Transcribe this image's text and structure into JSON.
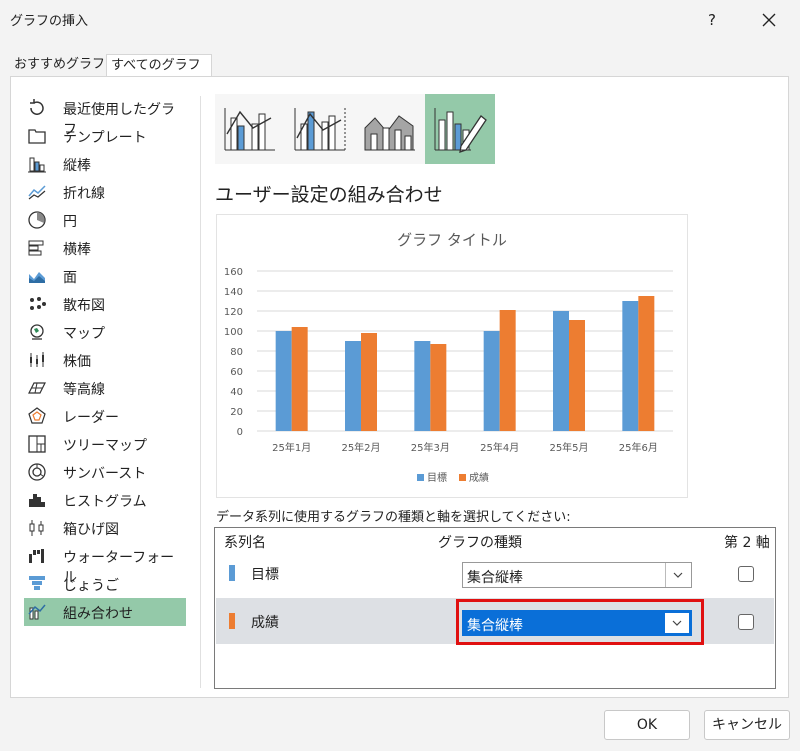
{
  "dialog": {
    "title": "グラフの挿入",
    "help": "?",
    "close_icon": "close-icon"
  },
  "tabs": [
    {
      "label": "おすすめグラフ"
    },
    {
      "label": "すべてのグラフ"
    }
  ],
  "chart_types": [
    {
      "label": "最近使用したグラフ",
      "icon": "recent-icon"
    },
    {
      "label": "テンプレート",
      "icon": "template-folder-icon"
    },
    {
      "label": "縦棒",
      "icon": "column-chart-icon"
    },
    {
      "label": "折れ線",
      "icon": "line-chart-icon"
    },
    {
      "label": "円",
      "icon": "pie-chart-icon"
    },
    {
      "label": "横棒",
      "icon": "bar-chart-icon"
    },
    {
      "label": "面",
      "icon": "area-chart-icon"
    },
    {
      "label": "散布図",
      "icon": "scatter-chart-icon"
    },
    {
      "label": "マップ",
      "icon": "map-chart-icon"
    },
    {
      "label": "株価",
      "icon": "stock-chart-icon"
    },
    {
      "label": "等高線",
      "icon": "surface-chart-icon"
    },
    {
      "label": "レーダー",
      "icon": "radar-chart-icon"
    },
    {
      "label": "ツリーマップ",
      "icon": "treemap-chart-icon"
    },
    {
      "label": "サンバースト",
      "icon": "sunburst-chart-icon"
    },
    {
      "label": "ヒストグラム",
      "icon": "histogram-chart-icon"
    },
    {
      "label": "箱ひげ図",
      "icon": "box-whisker-chart-icon"
    },
    {
      "label": "ウォーターフォール",
      "icon": "waterfall-chart-icon"
    },
    {
      "label": "じょうご",
      "icon": "funnel-chart-icon"
    },
    {
      "label": "組み合わせ",
      "icon": "combo-chart-icon"
    }
  ],
  "selected_chart_type": "組み合わせ",
  "section_title": "ユーザー設定の組み合わせ",
  "chart_data": {
    "type": "bar",
    "title": "グラフ タイトル",
    "categories": [
      "25年1月",
      "25年2月",
      "25年3月",
      "25年4月",
      "25年5月",
      "25年6月"
    ],
    "series": [
      {
        "name": "目標",
        "values": [
          100,
          90,
          90,
          100,
          120,
          130
        ],
        "color": "#5b9bd5"
      },
      {
        "name": "成績",
        "values": [
          104,
          98,
          87,
          121,
          111,
          135
        ],
        "color": "#ed7d31"
      }
    ],
    "y_ticks": [
      "0",
      "20",
      "40",
      "60",
      "80",
      "100",
      "120",
      "140",
      "160"
    ],
    "ylim": [
      0,
      160
    ],
    "grid": true,
    "legend": "bottom"
  },
  "instruction": "データ系列に使用するグラフの種類と軸を選択してください:",
  "series_table": {
    "headers": {
      "name": "系列名",
      "type": "グラフの種類",
      "axis": "第 2 軸"
    },
    "rows": [
      {
        "name": "目標",
        "type": "集合縦棒",
        "secondary_axis": false,
        "color": "#5b9bd5"
      },
      {
        "name": "成績",
        "type": "集合縦棒",
        "secondary_axis": false,
        "color": "#ed7d31"
      }
    ]
  },
  "buttons": {
    "ok": "OK",
    "cancel": "キャンセル"
  }
}
